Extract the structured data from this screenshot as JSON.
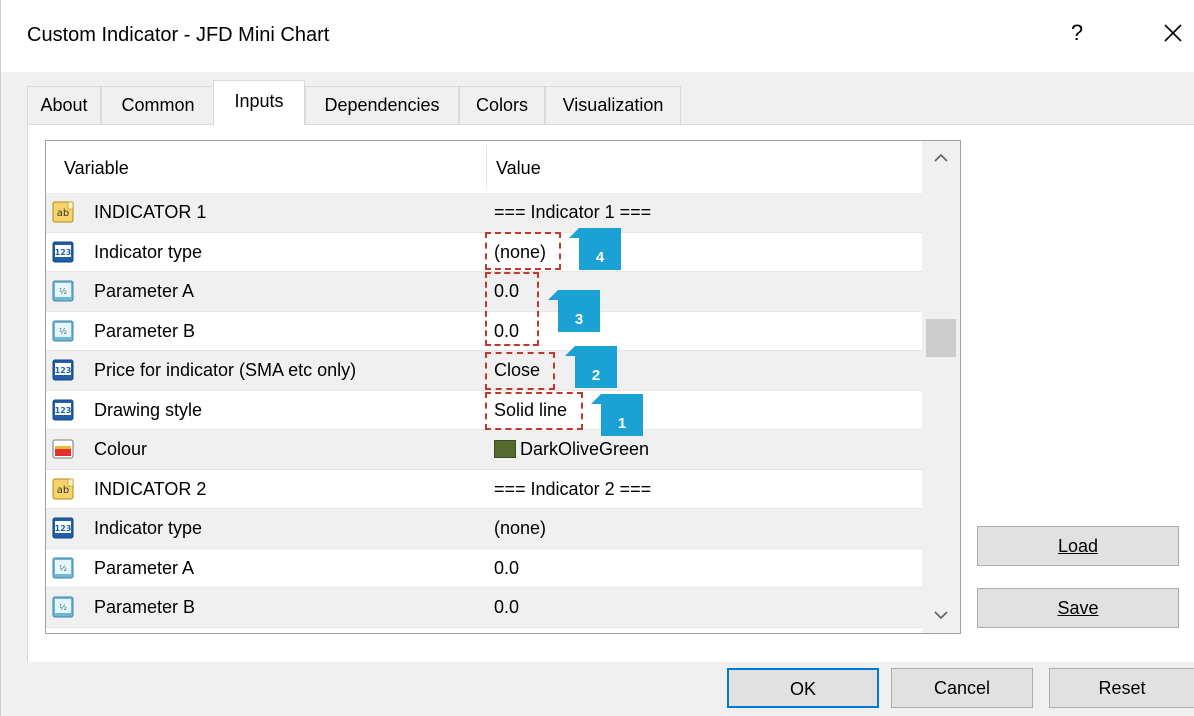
{
  "window": {
    "title": "Custom Indicator - JFD Mini Chart",
    "help_label": "?"
  },
  "tabs": [
    {
      "label": "About"
    },
    {
      "label": "Common"
    },
    {
      "label": "Inputs"
    },
    {
      "label": "Dependencies"
    },
    {
      "label": "Colors"
    },
    {
      "label": "Visualization"
    }
  ],
  "grid": {
    "col_variable": "Variable",
    "col_value": "Value",
    "rows": [
      {
        "icon": "string-icon",
        "name": "INDICATOR 1",
        "value": "=== Indicator 1 ==="
      },
      {
        "icon": "integer-icon",
        "name": "Indicator type",
        "value": "(none)"
      },
      {
        "icon": "double-icon",
        "name": "Parameter A",
        "value": "0.0"
      },
      {
        "icon": "double-icon",
        "name": "Parameter B",
        "value": "0.0"
      },
      {
        "icon": "integer-icon",
        "name": "Price for indicator (SMA etc only)",
        "value": "Close"
      },
      {
        "icon": "integer-icon",
        "name": "Drawing style",
        "value": "Solid line"
      },
      {
        "icon": "color-icon",
        "name": "Colour",
        "value": "DarkOliveGreen",
        "swatch": "#556b2f"
      },
      {
        "icon": "string-icon",
        "name": "INDICATOR 2",
        "value": "=== Indicator 2 ==="
      },
      {
        "icon": "integer-icon",
        "name": "Indicator type",
        "value": "(none)"
      },
      {
        "icon": "double-icon",
        "name": "Parameter A",
        "value": "0.0"
      },
      {
        "icon": "double-icon",
        "name": "Parameter B",
        "value": "0.0"
      }
    ]
  },
  "callouts": [
    {
      "number": "4"
    },
    {
      "number": "3"
    },
    {
      "number": "2"
    },
    {
      "number": "1"
    }
  ],
  "buttons": {
    "load": "Load",
    "save": "Save",
    "ok": "OK",
    "cancel": "Cancel",
    "reset": "Reset"
  },
  "colors": {
    "callout_badge": "#1ba1d4",
    "callout_border": "#c0392b",
    "dark_olive_green": "#556b2f"
  }
}
